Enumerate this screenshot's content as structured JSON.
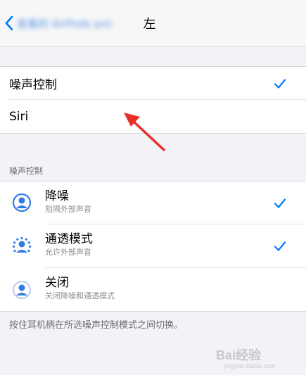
{
  "nav": {
    "back_label": "查看的 AirPods pro",
    "title": "左"
  },
  "press_options": [
    {
      "label": "噪声控制",
      "checked": true
    },
    {
      "label": "Siri",
      "checked": false
    }
  ],
  "noise_section": {
    "header": "噪声控制",
    "items": [
      {
        "title": "降噪",
        "subtitle": "阻隔外部声音",
        "checked": true,
        "icon": "noise-cancellation-icon"
      },
      {
        "title": "通透模式",
        "subtitle": "允许外部声音",
        "checked": true,
        "icon": "transparency-icon"
      },
      {
        "title": "关闭",
        "subtitle": "关闭降噪和通透模式",
        "checked": false,
        "icon": "noise-off-icon"
      }
    ],
    "footer": "按住耳机柄在所选噪声控制模式之间切换。"
  },
  "colors": {
    "accent": "#007aff",
    "arrow": "#e8302a",
    "icon_blue": "#2f7be5"
  },
  "watermark": {
    "brand": "Bai经验",
    "url": "jingyan.baidu.com"
  }
}
